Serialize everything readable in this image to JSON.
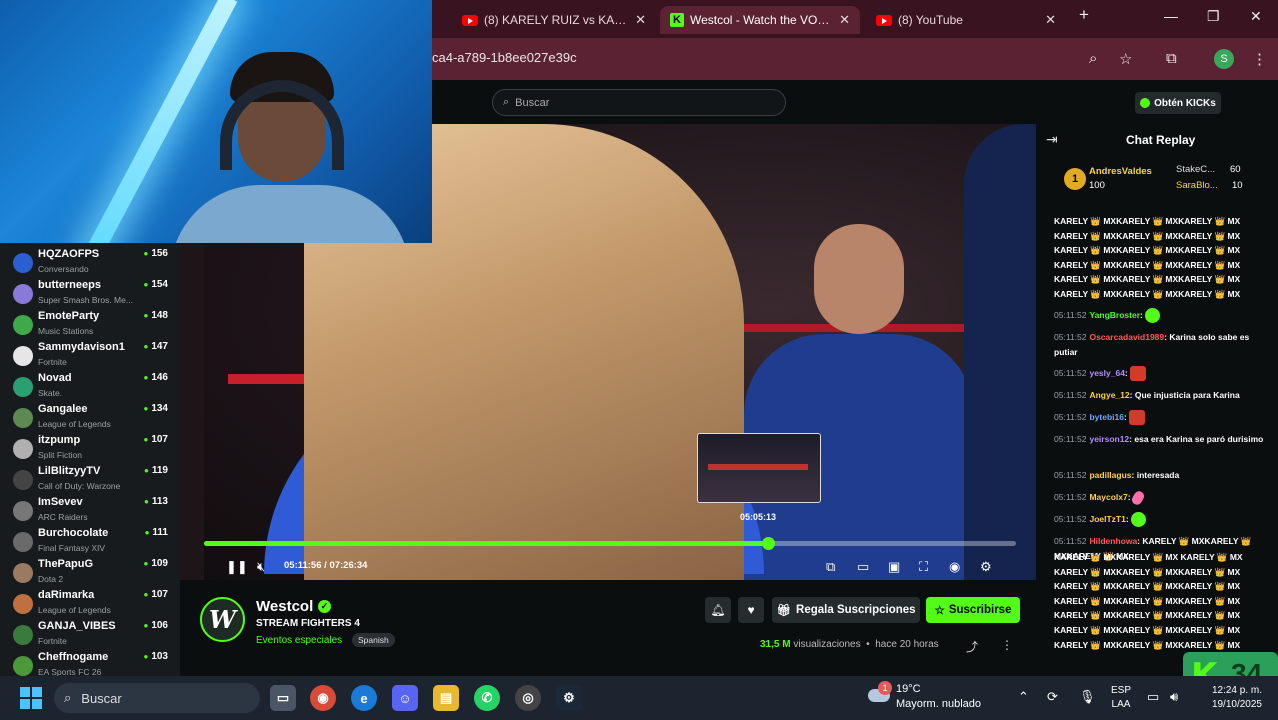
{
  "browser": {
    "tabs": [
      {
        "title": "(8) KARELY RUIZ vs KARINA",
        "icon": "youtube-icon"
      },
      {
        "title": "Westcol - Watch the VOD on",
        "icon": "kick-icon",
        "active": true
      },
      {
        "title": "(8) YouTube",
        "icon": "youtube-icon"
      }
    ],
    "url": "ca4-a789-1b8ee027e39c",
    "profile_initial": "S"
  },
  "kick": {
    "search_placeholder": "Buscar",
    "get_kicks_label": "Obtén KICKs"
  },
  "sidebar": {
    "channels": [
      {
        "name": "HQZAOFPS",
        "category": "Conversando",
        "viewers": "156",
        "color": "#2b5fd0"
      },
      {
        "name": "butterneeps",
        "category": "Super Smash Bros. Me...",
        "viewers": "154",
        "color": "#8a7ad8"
      },
      {
        "name": "EmoteParty",
        "category": "Music Stations",
        "viewers": "148",
        "color": "#3fa84a"
      },
      {
        "name": "Sammydavison1",
        "category": "Fortnite",
        "viewers": "147",
        "color": "#e6e6e6"
      },
      {
        "name": "Novad",
        "category": "Skate.",
        "viewers": "146",
        "color": "#2aa070"
      },
      {
        "name": "Gangalee",
        "category": "League of Legends",
        "viewers": "134",
        "color": "#5c8a50"
      },
      {
        "name": "itzpump",
        "category": "Split Fiction",
        "viewers": "107",
        "color": "#b0b0b0"
      },
      {
        "name": "LilBlitzyyTV",
        "category": "Call of Duty: Warzone",
        "viewers": "119",
        "color": "#444444"
      },
      {
        "name": "ImSevev",
        "category": "ARC Raiders",
        "viewers": "113",
        "color": "#777777"
      },
      {
        "name": "Burchocolate",
        "category": "Final Fantasy XIV",
        "viewers": "111",
        "color": "#6a6a6a"
      },
      {
        "name": "ThePapuG",
        "category": "Dota 2",
        "viewers": "109",
        "color": "#9a7a60"
      },
      {
        "name": "daRimarka",
        "category": "League of Legends",
        "viewers": "107",
        "color": "#c07040"
      },
      {
        "name": "GANJA_VIBES",
        "category": "Fortnite",
        "viewers": "106",
        "color": "#3a7a3a"
      },
      {
        "name": "Cheffnogame",
        "category": "EA Sports FC 26",
        "viewers": "103",
        "color": "#4a9a3a"
      }
    ]
  },
  "player": {
    "hover_time": "05:05:13",
    "current_time": "05:11:56",
    "duration": "07:26:34",
    "progress": 0.69
  },
  "stream": {
    "channel": "Westcol",
    "avatar_letter": "W",
    "title": "STREAM FIGHTERS 4",
    "category": "Eventos especiales",
    "language": "Spanish",
    "gift_label": "Regala Suscripciones",
    "subscribe_label": "Suscribirse",
    "views": "31,5 M",
    "views_label": "visualizaciones",
    "ago": "hace 20 horas"
  },
  "chat": {
    "title": "Chat Replay",
    "leaderboard": {
      "rank": "1",
      "first": {
        "name": "AndresValdes",
        "value": "100"
      },
      "second": {
        "name": "StakeC...",
        "value": "60"
      },
      "third": {
        "name": "SaraBlo...",
        "value": "10"
      }
    },
    "spam_lines": [
      "KARELY 👑 MXKARELY 👑 MXKARELY 👑 MX",
      "KARELY 👑 MXKARELY 👑 MXKARELY 👑 MX",
      "KARELY 👑 MXKARELY 👑 MXKARELY 👑 MX",
      "KARELY 👑 MXKARELY 👑 MXKARELY 👑 MX",
      "KARELY 👑 MXKARELY 👑 MXKARELY 👑 MX",
      "KARELY 👑 MXKARELY 👑 MXKARELY 👑 MX"
    ],
    "messages": [
      {
        "ts": "05:11:52",
        "user": "YangBroster",
        "text": ":"
      },
      {
        "ts": "05:11:52",
        "user": "Oscarcadavid1989",
        "text": ": Karina solo sabe es putiar"
      },
      {
        "ts": "05:11:52",
        "user": "yesly_64",
        "text": ":"
      },
      {
        "ts": "05:11:52",
        "user": "Angye_12",
        "text": ": Que injusticia para Karina"
      },
      {
        "ts": "05:11:52",
        "user": "bytebi16",
        "text": ":"
      },
      {
        "ts": "05:11:52",
        "user": "yeirson12",
        "text": ": esa era Karina se paró durisimo"
      },
      {
        "ts": "05:11:52",
        "user": "padillagus",
        "text": ": interesada"
      },
      {
        "ts": "05:11:52",
        "user": "Maycolx7",
        "text": ":"
      },
      {
        "ts": "05:11:52",
        "user": "JoelTzT1",
        "text": ":"
      },
      {
        "ts": "05:11:52",
        "user": "Hildenhowa",
        "text": ": KARELY 👑 MXKARELY 👑 MXKARELY 👑 MX"
      }
    ],
    "spam_lines_bottom": [
      "KARELY 👑 MXKARELY 👑 MX KARELY 👑 MX",
      "KARELY 👑 MXKARELY 👑 MXKARELY 👑 MX",
      "KARELY 👑 MXKARELY 👑 MXKARELY 👑 MX",
      "KARELY 👑 MXKARELY 👑 MXKARELY 👑 MX",
      "KARELY 👑 MXKARELY 👑 MXKARELY 👑 MX",
      "KARELY 👑 MXKARELY 👑 MXKARELY 👑 MX",
      "KARELY 👑 MXKARELY 👑 MXKARELY 👑 MX"
    ],
    "overlay_number": "34"
  },
  "taskbar": {
    "search_label": "Buscar",
    "weather_temp": "19°C",
    "weather_desc": "Mayorm. nublado",
    "weather_badge": "1",
    "lang_line1": "ESP",
    "lang_line2": "LAA",
    "time": "12:24 p. m.",
    "date": "19/10/2025"
  },
  "colors": {
    "kick_green": "#53fc18",
    "tab_bar": "#3a1320",
    "address_bar": "#5a2232"
  }
}
